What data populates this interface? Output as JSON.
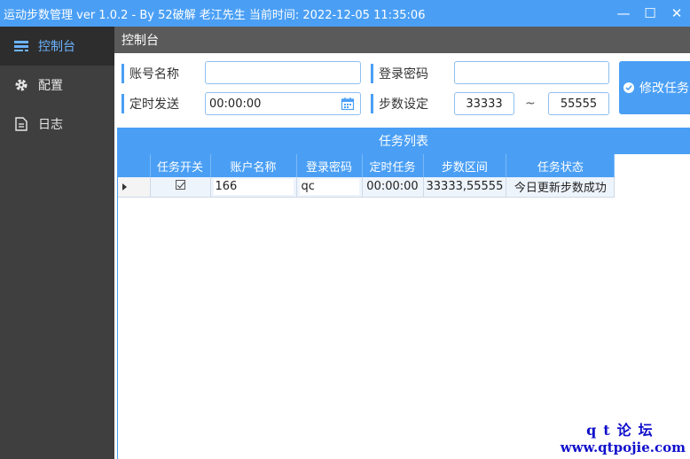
{
  "window": {
    "title": "运动步数管理 ver 1.0.2 - By 52破解 老江先生 当前时间:  2022-12-05 11:35:06",
    "minimize": "—",
    "maximize": "☐",
    "close": "✕"
  },
  "sidebar": {
    "items": [
      {
        "label": "控制台",
        "icon": "console-icon",
        "active": true
      },
      {
        "label": "配置",
        "icon": "gear-icon",
        "active": false
      },
      {
        "label": "日志",
        "icon": "document-icon",
        "active": false
      }
    ]
  },
  "main": {
    "breadcrumb": "控制台",
    "form": {
      "account_label": "账号名称",
      "account_value": "",
      "password_label": "登录密码",
      "password_value": "",
      "schedule_label": "定时发送",
      "schedule_value": "00:00:00",
      "steps_label": "步数设定",
      "steps_min": "33333",
      "steps_sep": "~",
      "steps_max": "55555",
      "modify_button": "修改任务"
    },
    "task_list": {
      "title": "任务列表",
      "columns": [
        "任务开关",
        "账户名称",
        "登录密码",
        "定时任务",
        "步数区间",
        "任务状态"
      ],
      "rows": [
        {
          "enabled": true,
          "account": "166",
          "password": "qc",
          "schedule": "00:00:00",
          "range": "33333,55555",
          "status": "今日更新步数成功"
        }
      ]
    }
  },
  "watermark": {
    "line1": "qt论坛",
    "line2": "www.qtpojie.com"
  },
  "colors": {
    "accent": "#4a9ff5",
    "sidebar_bg": "#3f3f3f",
    "active_text": "#6cb4ff"
  }
}
